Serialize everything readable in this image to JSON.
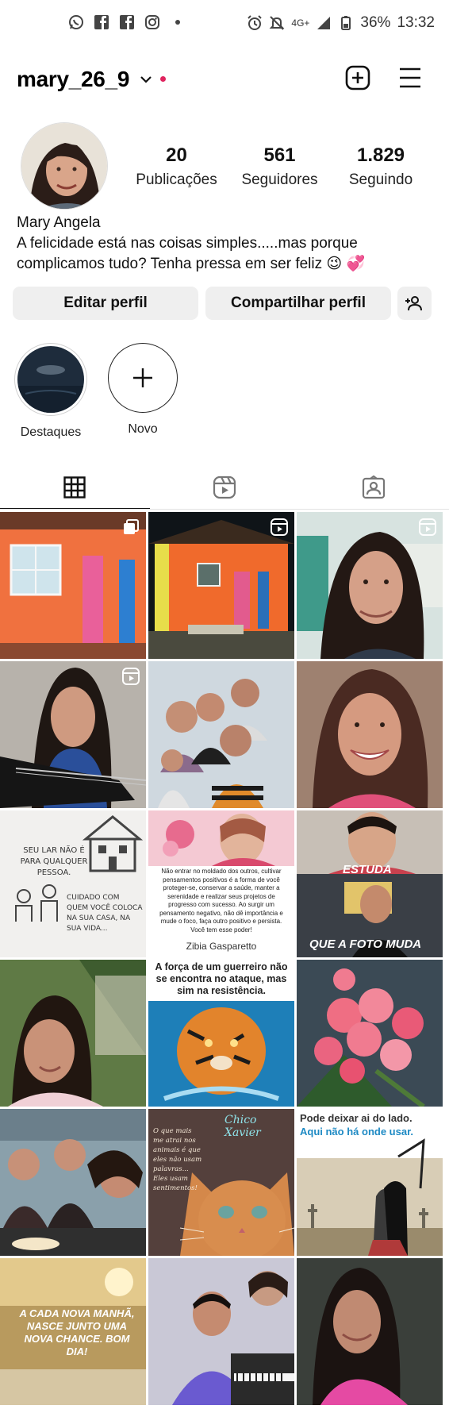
{
  "status_bar": {
    "network": "4G+",
    "battery": "36%",
    "time": "13:32"
  },
  "header": {
    "username": "mary_26_9"
  },
  "profile": {
    "stats": [
      {
        "value": "20",
        "label": "Publicações"
      },
      {
        "value": "561",
        "label": "Seguidores"
      },
      {
        "value": "1.829",
        "label": "Seguindo"
      }
    ],
    "display_name": "Mary Angela",
    "bio_line1": "A felicidade está nas coisas simples.....mas porque",
    "bio_line2": "complicamos tudo? Tenha pressa em ser feliz 😉 💞"
  },
  "buttons": {
    "edit": "Editar perfil",
    "share": "Compartilhar perfil"
  },
  "highlights": [
    {
      "label": "Destaques"
    },
    {
      "label": "Novo"
    }
  ],
  "posts": {
    "p7_text1": "SEU LAR NÃO É PARA QUALQUER PESSOA.",
    "p7_text2": "CUIDADO COM QUEM VOCÊ COLOCA NA SUA CASA, NA SUA VIDA...",
    "p8_text": "Não entrar no moldado dos outros, cultivar pensamentos positivos é a forma de você proteger-se, conservar a saúde, manter a serenidade e realizar seus projetos de progresso com sucesso. Ao surgir um pensamento negativo, não dê importância e mude o foco, faça outro positivo e persista. Você tem esse poder!",
    "p8_author": "Zibia Gasparetto",
    "p9_top": "ESTUDA",
    "p9_bottom": "QUE A FOTO MUDA",
    "p11_text": "A força de um guerreiro não se encontra no ataque, mas sim na resistência.",
    "p14_sign": "Chico Xavier",
    "p14_text": "O que mais me atrai nos animais é que eles não usam palavras... Eles usam sentimentos!",
    "p15_line1": "Pode deixar ai do lado.",
    "p15_line2": "Aqui não há onde usar.",
    "p16_text": "A CADA NOVA MANHÃ, NASCE JUNTO UMA NOVA CHANCE. BOM DIA!"
  },
  "colors": {
    "accent_red": "#e0245e",
    "button_bg": "#efefef"
  }
}
